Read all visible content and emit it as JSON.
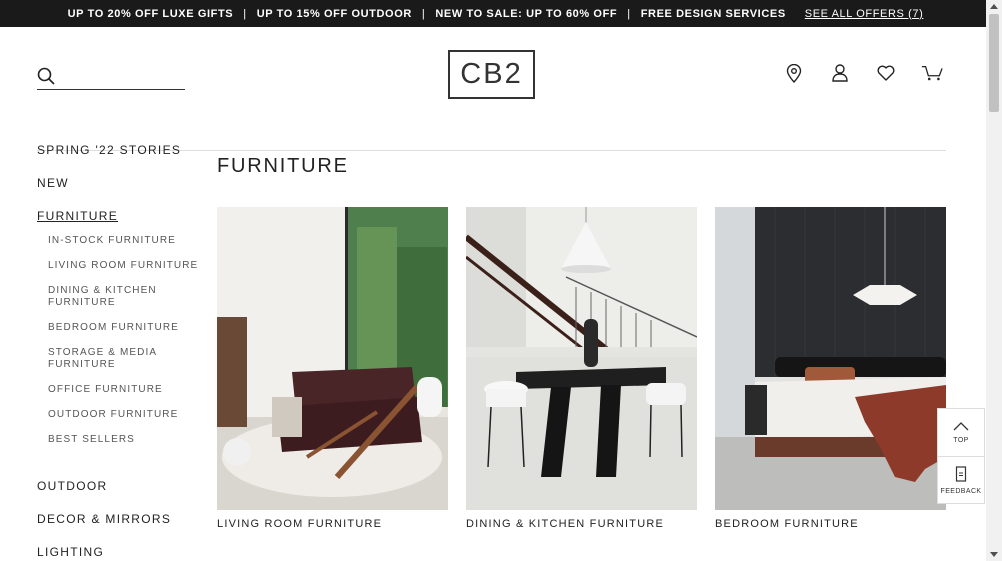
{
  "promo": {
    "items": [
      "UP TO 20% OFF LUXE GIFTS",
      "UP TO 15% OFF OUTDOOR",
      "NEW TO SALE: UP TO 60% OFF",
      "FREE DESIGN SERVICES"
    ],
    "separator": "|",
    "see_all": "SEE ALL OFFERS (7)"
  },
  "header": {
    "logo": "CB2",
    "search_placeholder": "",
    "icons": [
      "location-icon",
      "account-icon",
      "wishlist-heart-icon",
      "cart-icon"
    ]
  },
  "sidebar": {
    "spring": "SPRING '22 STORIES",
    "new": "NEW",
    "furniture": "FURNITURE",
    "sub": {
      "in_stock": "IN-STOCK FURNITURE",
      "living": "LIVING ROOM FURNITURE",
      "dining_1": "DINING & KITCHEN",
      "dining_2": "FURNITURE",
      "bedroom": "BEDROOM FURNITURE",
      "storage_1": "STORAGE & MEDIA",
      "storage_2": "FURNITURE",
      "office": "OFFICE FURNITURE",
      "outdoor": "OUTDOOR FURNITURE",
      "best": "BEST SELLERS"
    },
    "outdoor": "OUTDOOR",
    "decor": "DECOR & MIRRORS",
    "lighting": "LIGHTING"
  },
  "main": {
    "title": "FURNITURE",
    "cards": [
      "LIVING ROOM FURNITURE",
      "DINING & KITCHEN FURNITURE",
      "BEDROOM FURNITURE"
    ]
  },
  "floating": {
    "top": "TOP",
    "feedback": "FEEDBACK"
  },
  "colors": {
    "promo_bg": "#1a1a1a",
    "text": "#222222",
    "sub_text": "#555555",
    "rule": "#dddddd"
  }
}
